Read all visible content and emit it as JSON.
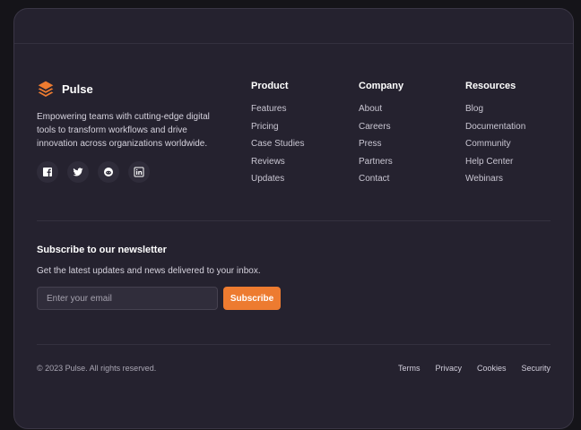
{
  "brand": {
    "name": "Pulse",
    "tagline": "Empowering teams with cutting-edge digital tools to transform workflows and drive innovation across organizations worldwide.",
    "accent_color": "#ed7b30",
    "logo_icon": "stacked-layers-icon"
  },
  "socials": [
    {
      "icon": "facebook-icon",
      "label": "Facebook"
    },
    {
      "icon": "twitter-icon",
      "label": "Twitter"
    },
    {
      "icon": "reddit-icon",
      "label": "Reddit"
    },
    {
      "icon": "linkedin-icon",
      "label": "LinkedIn"
    }
  ],
  "columns": [
    {
      "title": "Product",
      "links": [
        "Features",
        "Pricing",
        "Case Studies",
        "Reviews",
        "Updates"
      ]
    },
    {
      "title": "Company",
      "links": [
        "About",
        "Careers",
        "Press",
        "Partners",
        "Contact"
      ]
    },
    {
      "title": "Resources",
      "links": [
        "Blog",
        "Documentation",
        "Community",
        "Help Center",
        "Webinars"
      ]
    }
  ],
  "newsletter": {
    "title": "Subscribe to our newsletter",
    "description": "Get the latest updates and news delivered to your inbox.",
    "placeholder": "Enter your email",
    "value": "",
    "button_label": "Subscribe"
  },
  "footer": {
    "copyright": "© 2023 Pulse. All rights reserved.",
    "legal_links": [
      "Terms",
      "Privacy",
      "Cookies",
      "Security"
    ]
  }
}
